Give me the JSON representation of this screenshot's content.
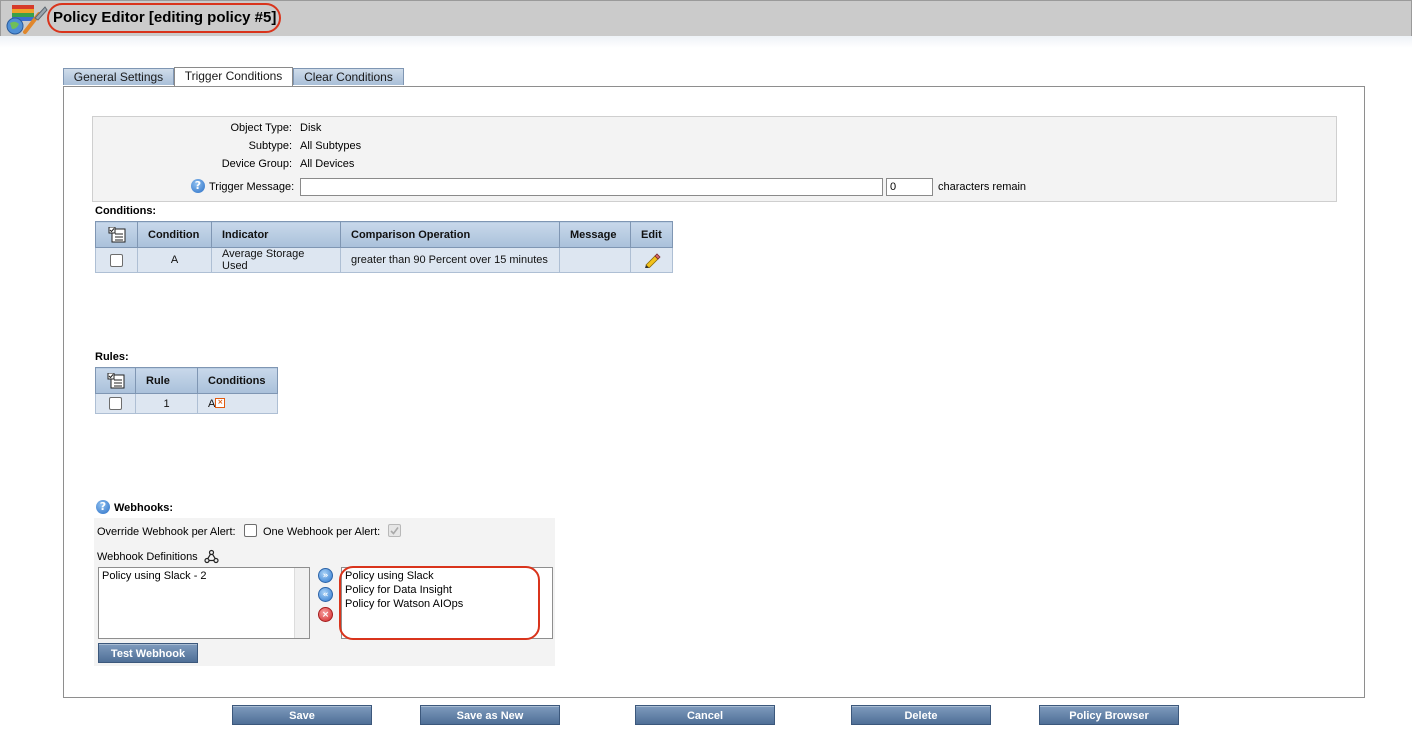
{
  "header": {
    "title": "Policy Editor [editing policy #5]"
  },
  "tabs": [
    {
      "label": "General Settings",
      "active": false
    },
    {
      "label": "Trigger Conditions",
      "active": true
    },
    {
      "label": "Clear Conditions",
      "active": false
    }
  ],
  "info": {
    "object_type_label": "Object Type:",
    "object_type_value": "Disk",
    "subtype_label": "Subtype:",
    "subtype_value": "All Subtypes",
    "device_group_label": "Device Group:",
    "device_group_value": "All Devices",
    "trigger_message_label": "Trigger Message:",
    "trigger_message_value": "",
    "chars_remaining_value": "0",
    "chars_remaining_text": "characters remain"
  },
  "conditions": {
    "title": "Conditions:",
    "headers": [
      "Condition",
      "Indicator",
      "Comparison Operation",
      "Message",
      "Edit"
    ],
    "rows": [
      {
        "condition": "A",
        "indicator": "Average Storage Used",
        "comparison": "greater than 90 Percent over 15 minutes",
        "message": ""
      }
    ]
  },
  "rules": {
    "title": "Rules:",
    "headers": [
      "Rule",
      "Conditions"
    ],
    "rows": [
      {
        "rule": "1",
        "conditions": "A"
      }
    ]
  },
  "webhooks": {
    "title": "Webhooks:",
    "override_label": "Override Webhook per Alert:",
    "one_per_alert_label": "One Webhook per Alert:",
    "definitions_label": "Webhook Definitions",
    "available": [
      "Policy using Slack - 2"
    ],
    "selected": [
      "Policy using Slack",
      "Policy for Data Insight",
      "Policy for Watson AIOps"
    ],
    "test_button": "Test Webhook"
  },
  "footer": {
    "save": "Save",
    "save_as_new": "Save as New",
    "cancel": "Cancel",
    "delete": "Delete",
    "policy_browser": "Policy Browser"
  },
  "colors": {
    "highlight": "#d9341c",
    "tab_blue": "#a9bfd8",
    "button": "#5a7aa2"
  }
}
